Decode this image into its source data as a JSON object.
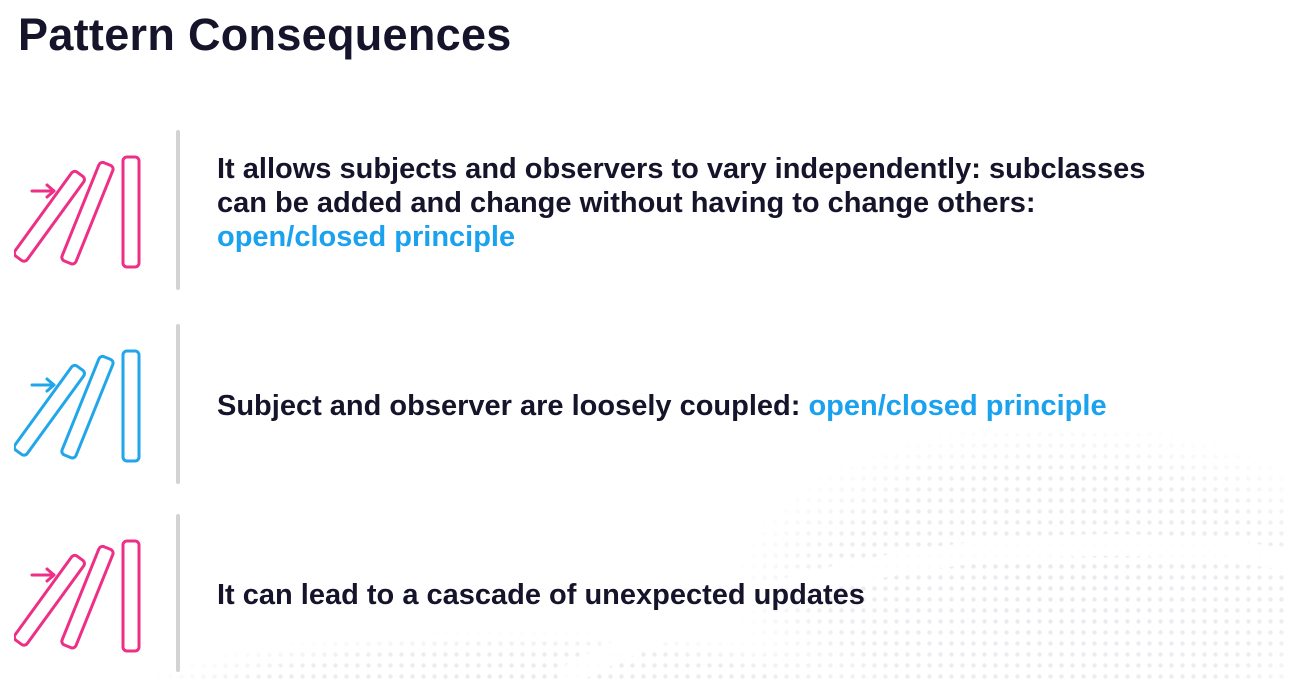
{
  "slide": {
    "title": "Pattern Consequences",
    "colors": {
      "text": "#15142a",
      "highlight": "#1aa2ee",
      "pink": "#ee2f86",
      "blue": "#21a6ea",
      "divider": "#d3d3d6"
    },
    "items": [
      {
        "icon": "dominoes-icon",
        "icon_color": "pink",
        "line1": "It allows subjects and observers to vary independently: subclasses",
        "line2": "can be added and change without having to change others:",
        "link": "open/closed principle"
      },
      {
        "icon": "dominoes-icon",
        "icon_color": "blue",
        "text": "Subject and observer are loosely coupled: ",
        "link": "open/closed principle"
      },
      {
        "icon": "dominoes-icon",
        "icon_color": "pink",
        "text": "It can lead to a cascade of unexpected updates"
      }
    ]
  }
}
